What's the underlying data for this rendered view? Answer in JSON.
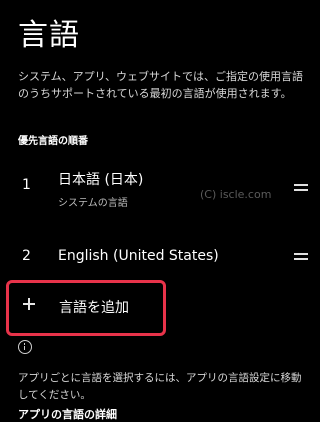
{
  "page": {
    "title": "言語",
    "description": "システム、アプリ、ウェブサイトでは、ご指定の使用言語のうちサポートされている最初の言語が使用されます。"
  },
  "preferred_section": {
    "header": "優先言語の順番",
    "languages": [
      {
        "index": "1",
        "name": "日本語 (日本)",
        "subtitle": "システムの言語",
        "drag_icon": "drag-handle-icon"
      },
      {
        "index": "2",
        "name": "English (United States)",
        "drag_icon": "drag-handle-icon"
      }
    ]
  },
  "watermark": "(C) iscle.com",
  "add_language": {
    "label": "言語を追加",
    "icon": "plus-icon",
    "highlight_color": "#e8334a"
  },
  "footer": {
    "info_icon": "info-icon",
    "text": "アプリごとに言語を選択するには、アプリの言語設定に移動してください。",
    "link_label": "アプリの言語の詳細"
  }
}
